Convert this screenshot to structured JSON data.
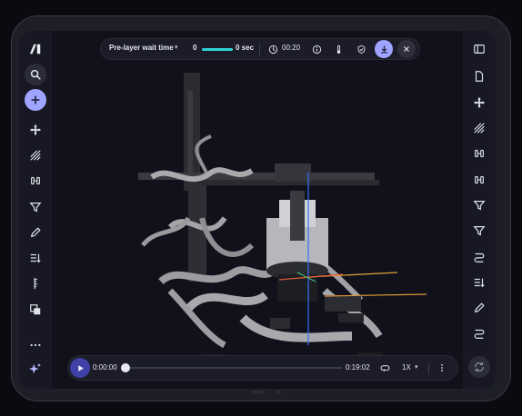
{
  "toolbar": {
    "mode_label": "Pre-layer wait time",
    "slider_min": "0",
    "slider_value": "0 sec",
    "time_label": "00:20"
  },
  "playback": {
    "current_time": "0:00:00",
    "total_time": "0:19:02",
    "speed": "1X",
    "progress": 0
  },
  "left_tools": [
    "logo",
    "search",
    "add",
    "move",
    "hatch",
    "align",
    "filter",
    "pencil",
    "sort",
    "ruler",
    "layers",
    "more",
    "sparkle"
  ],
  "right_tools": [
    "panel",
    "document",
    "move",
    "hatch",
    "align",
    "align",
    "filter",
    "filter",
    "route",
    "sort",
    "pencil",
    "sync"
  ],
  "colors": {
    "accent": "#9ea4ff",
    "cyan": "#2ed3d6",
    "play": "#3e42a6",
    "background": "#10111a"
  }
}
